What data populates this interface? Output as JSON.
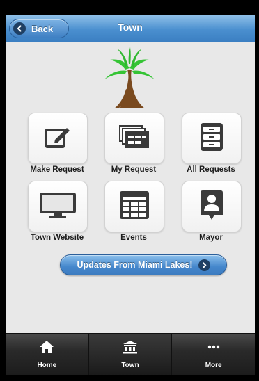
{
  "header": {
    "back_label": "Back",
    "title": "Town",
    "icon": "chevron-left-icon"
  },
  "tiles": [
    {
      "label": "Make Request",
      "icon": "edit-icon"
    },
    {
      "label": "My Request",
      "icon": "stacked-documents-icon"
    },
    {
      "label": "All Requests",
      "icon": "file-cabinet-icon"
    },
    {
      "label": "Town Website",
      "icon": "monitor-icon"
    },
    {
      "label": "Events",
      "icon": "calendar-icon"
    },
    {
      "label": "Mayor",
      "icon": "person-badge-icon"
    }
  ],
  "updates_button": {
    "label": "Updates From Miami Lakes!",
    "icon": "chevron-right-icon"
  },
  "navbar": {
    "items": [
      {
        "label": "Home",
        "icon": "home-icon"
      },
      {
        "label": "Town",
        "icon": "building-icon"
      },
      {
        "label": "More",
        "icon": "ellipsis-icon"
      }
    ],
    "active": "Town"
  },
  "colors": {
    "header_blue": "#4a8fcf",
    "palm_green": "#2fbf2f",
    "trunk_brown": "#7a4a1f",
    "icon_dark": "#3a3a3a",
    "background": "#e8e8e8"
  }
}
